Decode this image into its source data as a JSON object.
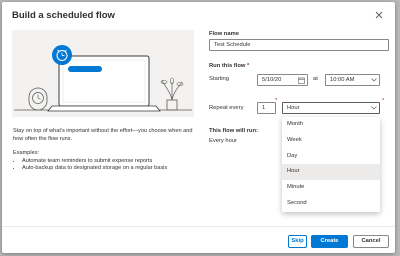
{
  "dialog": {
    "title": "Build a scheduled flow"
  },
  "left": {
    "description": "Stay on top of what's important without the effort—you choose when and how often the flow runs.",
    "examples_heading": "Examples:",
    "examples": [
      "Automate team reminders to submit expense reports",
      "Auto-backup data to designated storage on a regular basis"
    ]
  },
  "form": {
    "flow_name_label": "Flow name",
    "flow_name_value": "Test Schedule",
    "run_label": "Run this flow",
    "required_mark": "*",
    "starting_label": "Starting",
    "start_date": "5/10/20",
    "at_label": "at",
    "start_time": "10:00 AM",
    "repeat_label": "Repeat every",
    "repeat_value": "1",
    "repeat_unit": "Hour",
    "will_run_heading": "This flow will run:",
    "will_run_text": "Every hour"
  },
  "frequency_menu": {
    "options": [
      "Month",
      "Week",
      "Day",
      "Hour",
      "Minute",
      "Second"
    ],
    "selected": "Hour"
  },
  "footer": {
    "skip_label": "Skip",
    "create_label": "Create",
    "cancel_label": "Cancel"
  },
  "colors": {
    "accent": "#0078d4",
    "illustration_bg": "#f3f2f1",
    "selected_item_bg": "#edebe9",
    "required_red": "#a4262c"
  },
  "icons": {
    "close": "close-icon",
    "calendar": "calendar-icon",
    "chevron": "chevron-down-icon",
    "alarm": "alarm-clock-icon",
    "laptop": "laptop-icon",
    "clock": "wall-clock-icon",
    "plant": "plant-icon"
  }
}
